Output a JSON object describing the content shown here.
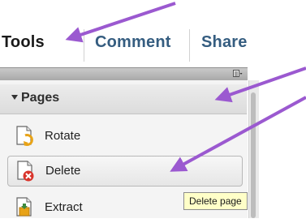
{
  "tabs": [
    {
      "label": "Tools",
      "active": true
    },
    {
      "label": "Comment",
      "active": false
    },
    {
      "label": "Share",
      "active": false
    }
  ],
  "panel": {
    "section_title": "Pages",
    "options_icon": "panel-options-icon",
    "items": [
      {
        "label": "Rotate",
        "icon": "rotate-page-icon"
      },
      {
        "label": "Delete",
        "icon": "delete-page-icon",
        "hovered": true
      },
      {
        "label": "Extract",
        "icon": "extract-page-icon"
      }
    ]
  },
  "tooltip": {
    "text": "Delete page"
  },
  "annotation": {
    "arrow_color": "#9b59d0",
    "arrow_count": 4
  },
  "colors": {
    "active_tab": "#1a1a1a",
    "inactive_tab": "#355d80",
    "delete_badge": "#d9342b",
    "tooltip_bg": "#ffffc8"
  }
}
